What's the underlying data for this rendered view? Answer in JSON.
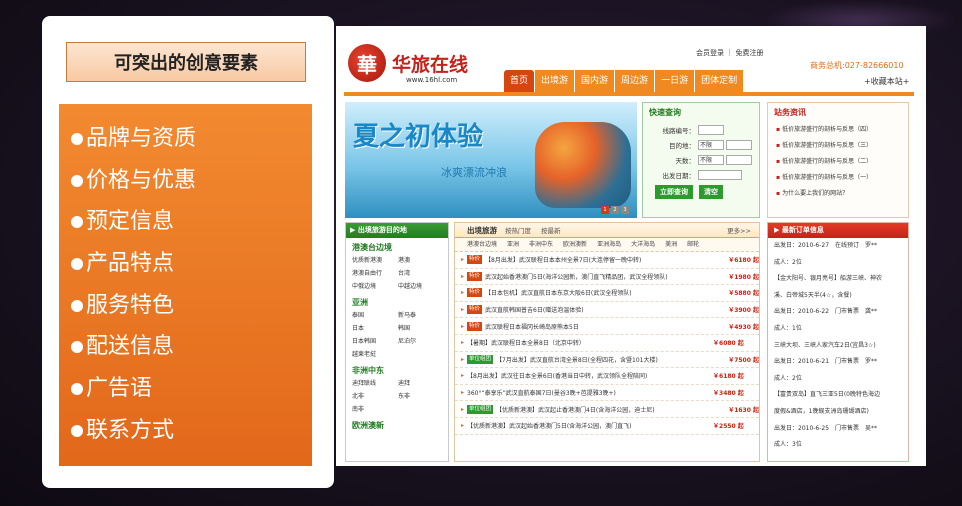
{
  "left": {
    "title": "可突出的创意要素",
    "items": [
      "品牌与资质",
      "价格与优惠",
      "预定信息",
      "产品特点",
      "服务特色",
      "配送信息",
      "广告语",
      "联系方式"
    ]
  },
  "site": {
    "logo_char": "華",
    "logo_name": "华旅在线",
    "logo_url": "www.16hl.com",
    "top_links": "会员登录 ｜ 免费注册",
    "hotline": "商务总机:027-82666010",
    "favorite": "+收藏本站+",
    "nav": [
      "首页",
      "出境游",
      "国内游",
      "周边游",
      "一日游",
      "团体定制"
    ],
    "banner_title": "夏之初体验",
    "banner_sub": "冰爽漂流冲浪",
    "banner_pages": [
      "1",
      "2",
      "3"
    ],
    "search": {
      "title": "快速查询",
      "route_label": "线路编号：",
      "dest_label": "目的地：",
      "dest_value": "不限",
      "days_label": "天数：",
      "days_value": "不限",
      "date_label": "出发日期：",
      "btn_search": "立即查询",
      "btn_clear": "清空"
    },
    "news": {
      "title": "站务资讯",
      "items": [
        "低价旅游盛行的剖析与反思（四）",
        "低价旅游盛行的剖析与反思（三）",
        "低价旅游盛行的剖析与反思（二）",
        "低价旅游盛行的剖析与反思（一）",
        "为什么要上我们的网站？"
      ]
    },
    "dest": {
      "title": "出境旅游目的地",
      "groups": [
        {
          "name": "港澳台边境",
          "pairs": [
            [
              "优质新港澳",
              "港澳"
            ],
            [
              "港澳自由行",
              "台湾"
            ],
            [
              "中俄边境",
              "中越边境"
            ]
          ]
        },
        {
          "name": "亚洲",
          "pairs": [
            [
              "泰国",
              "新马泰"
            ],
            [
              "日本",
              "韩国"
            ],
            [
              "日本韩国",
              "尼泊尔"
            ],
            [
              "越柬老挝",
              ""
            ]
          ]
        },
        {
          "name": "非洲中东",
          "pairs": [
            [
              "迪拜联线",
              "迪拜"
            ],
            [
              "北非",
              "东非"
            ],
            [
              "南非",
              ""
            ]
          ]
        },
        {
          "name": "欧洲澳新",
          "pairs": []
        }
      ]
    },
    "tours": {
      "title": "出境旅游",
      "subtabs": [
        "按热门度",
        "按最新"
      ],
      "more": "更多>>",
      "cats": [
        "港澳台边境",
        "亚洲",
        "非洲中东",
        "欧洲澳新",
        "亚洲海岛",
        "大洋海岛",
        "美洲",
        "邮轮"
      ],
      "rows": [
        {
          "tag": "特价",
          "tag_color": "#d4470f",
          "title": "【8月出发】武汉联程日本本州全景7日(大连停留一晚中转)",
          "price": "￥6180 起"
        },
        {
          "tag": "特价",
          "tag_color": "#d4470f",
          "title": "武汉起始香港澳门5日(海洋公园新，澳门直飞精品团，武汉全程领队)",
          "price": "￥1980 起"
        },
        {
          "tag": "特价",
          "tag_color": "#d4470f",
          "title": "【日本包机】武汉直航日本东京大阪6日(武汉全程领队)",
          "price": "￥5880 起"
        },
        {
          "tag": "特价",
          "tag_color": "#d4470f",
          "title": "武汉直航韩国普吉6日(赠送泡温体验)",
          "price": "￥3900 起"
        },
        {
          "tag": "特价",
          "tag_color": "#d4470f",
          "title": "武汉联程日本福冈长崎岛原熊本5日",
          "price": "￥4930 起"
        },
        {
          "tag": "",
          "tag_color": "",
          "title": "【暑期】武汉联程日本全景8日（北京中转）",
          "price": "￥6080 起"
        },
        {
          "tag": "单位组团",
          "tag_color": "#2c9a2c",
          "title": "【7月出发】武汉直航台湾全景8日(全程四花，含暨101大楼)",
          "price": "￥7500 起"
        },
        {
          "tag": "",
          "tag_color": "",
          "title": "【8月出发】武汉往日本全景6日(香港当日中转，武汉领队全程陪同)",
          "price": "￥6180 起"
        },
        {
          "tag": "",
          "tag_color": "",
          "title": "360°“泰享乐”武汉直航泰国7日(曼谷3晚+芭提雅3晚+)",
          "price": "￥3480 起"
        },
        {
          "tag": "单位组团",
          "tag_color": "#2c9a2c",
          "title": "【优质新港澳】武汉起止香港澳门4日(含海洋公园，迪士尼)",
          "price": "￥1630 起"
        },
        {
          "tag": "",
          "tag_color": "",
          "title": "【优质新港澳】武汉起始香港澳门5日(含海洋公园，澳门直飞)",
          "price": "￥2550 起"
        }
      ]
    },
    "orders": {
      "title": "最新订单信息",
      "lines": [
        "出发日：2010-6-27　在线预订　罗**",
        "成人：2位",
        "【金大阳号、银月亮号】船游三峡、神农",
        "溪、白帝城5天半(4☆，含餐)",
        "出发日：2010-6-22　门市售票　龚**",
        "成人：1位",
        "三峡大坝、三峡人家汽车2日(宜昌3☆)",
        "出发日：2010-6-21　门市售票　罗**",
        "成人：2位",
        "【富贵双岛】直飞三亚5日(0晚特色海边",
        "度假&酒店，1晚蜈支洲岛珊瑚酒店)",
        "出发日：2010-6-25　门市售票　吴**",
        "成人：3位"
      ]
    }
  }
}
